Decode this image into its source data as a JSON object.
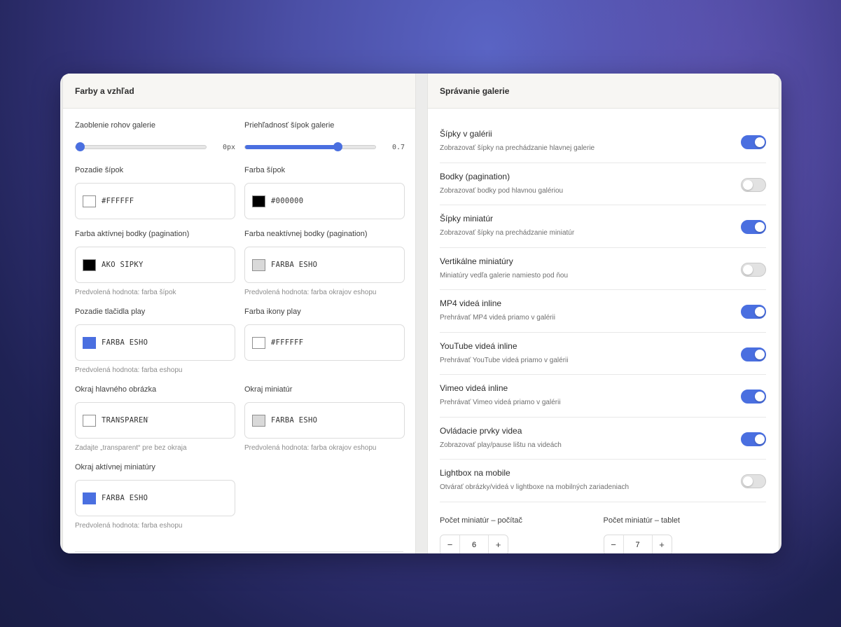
{
  "left_panel": {
    "title": "Farby a vzhľad",
    "sliders": [
      {
        "label": "Zaoblenie rohov galerie",
        "value_text": "0px",
        "value": 0
      },
      {
        "label": "Priehľadnosť šípok galerie",
        "value_text": "0.7",
        "value": 0.7
      }
    ],
    "colors": [
      {
        "label": "Pozadie šípok",
        "value": "#FFFFFF",
        "swatch": "#ffffff",
        "hint": ""
      },
      {
        "label": "Farba šípok",
        "value": "#000000",
        "swatch": "#000000",
        "hint": ""
      },
      {
        "label": "Farba aktívnej bodky (pagination)",
        "value": "AKO ŠÍPKY",
        "swatch": "#000000",
        "hint": "Predvolená hodnota: farba šípok"
      },
      {
        "label": "Farba neaktívnej bodky (pagination)",
        "value": "FARBA ESHOP",
        "swatch": "#d9d9d9",
        "hint": "Predvolená hodnota: farba okrajov eshopu"
      },
      {
        "label": "Pozadie tlačidla play",
        "value": "FARBA ESHOP",
        "swatch": "#4a6fe0",
        "hint": "Predvolená hodnota: farba eshopu"
      },
      {
        "label": "Farba ikony play",
        "value": "#FFFFFF",
        "swatch": "#ffffff",
        "hint": ""
      },
      {
        "label": "Okraj hlavného obrázka",
        "value": "TRANSPARENT",
        "swatch": "#ffffff",
        "hint": "Zadajte „transparent“ pre bez okraja"
      },
      {
        "label": "Okraj miniatúr",
        "value": "FARBA ESHOP",
        "swatch": "#d9d9d9",
        "hint": "Predvolená hodnota: farba okrajov eshopu"
      },
      {
        "label": "Okraj aktívnej miniatúry",
        "value": "FARBA ESHOP",
        "swatch": "#4a6fe0",
        "hint": "Predvolená hodnota: farba eshopu"
      }
    ]
  },
  "right_panel": {
    "title": "Správanie galerie",
    "toggles": [
      {
        "title": "Šípky v galérii",
        "desc": "Zobrazovať šípky na prechádzanie hlavnej galerie",
        "on": true
      },
      {
        "title": "Bodky (pagination)",
        "desc": "Zobrazovať bodky pod hlavnou galériou",
        "on": false
      },
      {
        "title": "Šípky miniatúr",
        "desc": "Zobrazovať šípky na prechádzanie miniatúr",
        "on": true
      },
      {
        "title": "Vertikálne miniatúry",
        "desc": "Miniatúry vedľa galerie namiesto pod ňou",
        "on": false
      },
      {
        "title": "MP4 videá inline",
        "desc": "Prehrávať MP4 videá priamo v galérii",
        "on": true
      },
      {
        "title": "YouTube videá inline",
        "desc": "Prehrávať YouTube videá priamo v galérii",
        "on": true
      },
      {
        "title": "Vimeo videá inline",
        "desc": "Prehrávať Vimeo videá priamo v galérii",
        "on": true
      },
      {
        "title": "Ovládacie prvky videa",
        "desc": "Zobrazovať play/pause lištu na videách",
        "on": true
      },
      {
        "title": "Lightbox na mobile",
        "desc": "Otvárať obrázky/videá v lightboxe na mobilných zariadeniach",
        "on": false
      }
    ],
    "counts": [
      {
        "label": "Počet miniatúr – počítač",
        "value": "6",
        "minus": "−",
        "plus": "+"
      },
      {
        "label": "Počet miniatúr – tablet",
        "value": "7",
        "minus": "−",
        "plus": "+"
      }
    ]
  },
  "colors": {
    "accent": "#4a6fe0",
    "switch_off": "#e2e2e2"
  }
}
